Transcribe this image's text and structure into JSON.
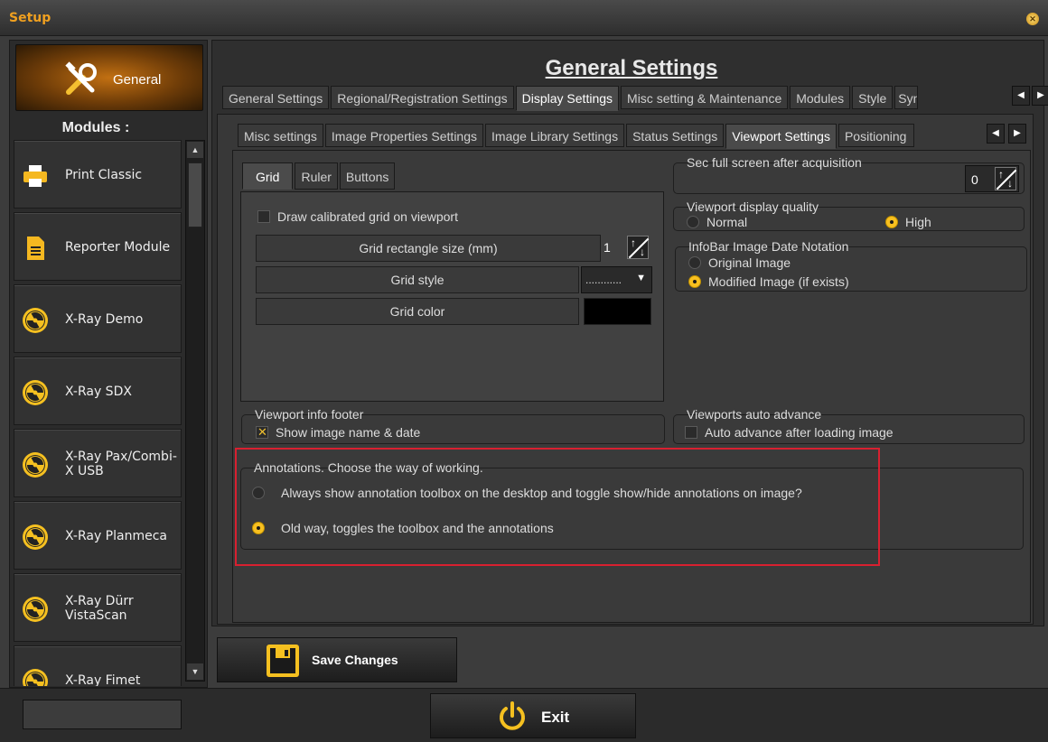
{
  "window": {
    "title": "Setup"
  },
  "sidebar": {
    "general_label": "General",
    "modules_label": "Modules :",
    "items": [
      {
        "label": "Print Classic",
        "icon": "printer-icon"
      },
      {
        "label": "Reporter Module",
        "icon": "document-icon"
      },
      {
        "label": "X-Ray Demo",
        "icon": "radiation-icon"
      },
      {
        "label": "X-Ray SDX",
        "icon": "radiation-icon"
      },
      {
        "label": "X-Ray Pax/Combi-X USB",
        "icon": "radiation-icon"
      },
      {
        "label": "X-Ray Planmeca",
        "icon": "radiation-icon"
      },
      {
        "label": "X-Ray Dürr VistaScan",
        "icon": "radiation-icon"
      },
      {
        "label": "X-Ray Fimet",
        "icon": "radiation-icon"
      }
    ]
  },
  "main": {
    "page_title": "General Settings",
    "top_tabs": [
      "General Settings",
      "Regional/Registration Settings",
      "Display Settings",
      "Misc setting & Maintenance",
      "Modules",
      "Style",
      "Syn"
    ],
    "top_tab_active": "Display Settings",
    "sub_tabs": [
      "Misc settings",
      "Image Properties Settings",
      "Image Library Settings",
      "Status Settings",
      "Viewport Settings",
      "Positioning"
    ],
    "sub_tab_active": "Viewport Settings",
    "grid_tabs": [
      "Grid",
      "Ruler",
      "Buttons"
    ],
    "grid_tab_active": "Grid",
    "grid": {
      "draw_calibrated_label": "Draw calibrated grid on viewport",
      "draw_calibrated_checked": false,
      "rect_size_label": "Grid rectangle size (mm)",
      "rect_size_value": "1",
      "style_label": "Grid style",
      "style_value": "............",
      "color_label": "Grid color",
      "color_value": "#000000"
    },
    "fullscreen": {
      "title": "Sec full screen after acquisition",
      "value": "0"
    },
    "quality": {
      "title": "Viewport display quality",
      "options": [
        "Normal",
        "High"
      ],
      "selected": "High"
    },
    "infobar": {
      "title": "InfoBar Image Date Notation",
      "options": [
        "Original Image",
        "Modified Image (if exists)"
      ],
      "selected": "Modified Image (if exists)"
    },
    "footer": {
      "title": "Viewport info footer",
      "label": "Show image name & date",
      "checked": true
    },
    "auto_advance": {
      "title": "Viewports auto advance",
      "label": "Auto advance after loading image",
      "checked": false
    },
    "annotations": {
      "title": "Annotations. Choose the way of working.",
      "options": [
        "Always show annotation toolbox on the desktop and toggle show/hide annotations on image?",
        "Old way, toggles the toolbox and the annotations"
      ],
      "selected_index": 1
    }
  },
  "actions": {
    "save_label": "Save Changes",
    "exit_label": "Exit"
  },
  "colors": {
    "accent": "#f0a020",
    "highlight_border": "#d82030",
    "radio_on": "#f8c020"
  }
}
